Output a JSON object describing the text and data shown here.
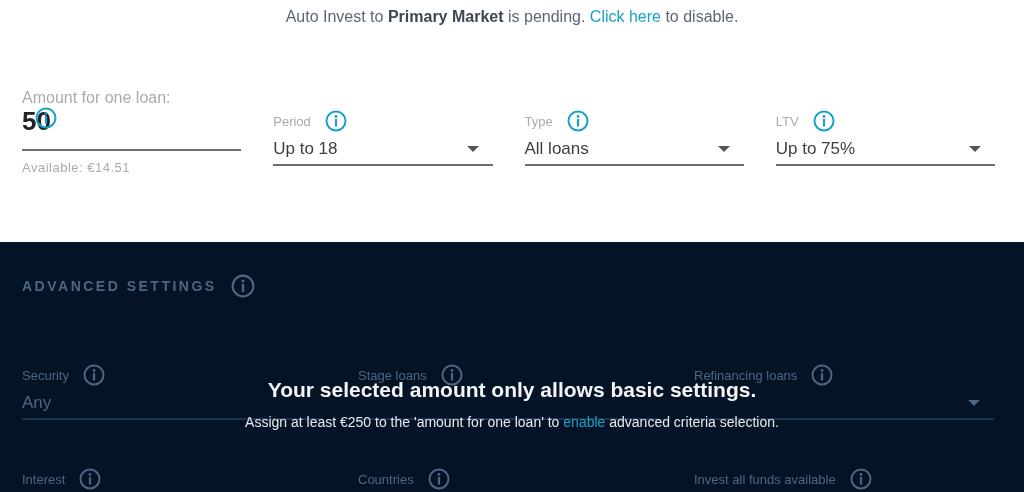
{
  "notice": {
    "text": "Auto Invest to **Primary Market** is pending.",
    "link": "Click here",
    "after": "to disable."
  },
  "amount": {
    "label": "Amount for one loan:",
    "value": "50",
    "available": "Available: €14.51"
  },
  "filters": [
    {
      "label": "Period",
      "value": "Up to 18"
    },
    {
      "label": "Type",
      "value": "All loans"
    },
    {
      "label": "LTV",
      "value": "Up to 75%"
    }
  ],
  "advanced": {
    "title": "ADVANCED SETTINGS",
    "locked": true,
    "rows": [
      [
        {
          "label": "Security",
          "value": "Any",
          "kind": "select",
          "arrow": false
        },
        {
          "label": "Stage loans",
          "kind": "select",
          "arrow": false
        },
        {
          "label": "Refinancing loans",
          "kind": "select",
          "arrow": true
        }
      ],
      [
        {
          "label": "Interest",
          "kind": "label"
        },
        {
          "label": "Countries",
          "kind": "label"
        },
        {
          "label": "Invest all funds available",
          "kind": "label"
        }
      ]
    ]
  },
  "overlay": {
    "title": "Your selected amount only allows basic settings.",
    "text": "Assign at least €250 to the 'amount for one loan' to",
    "link": "enable",
    "after": "advanced criteria selection."
  }
}
